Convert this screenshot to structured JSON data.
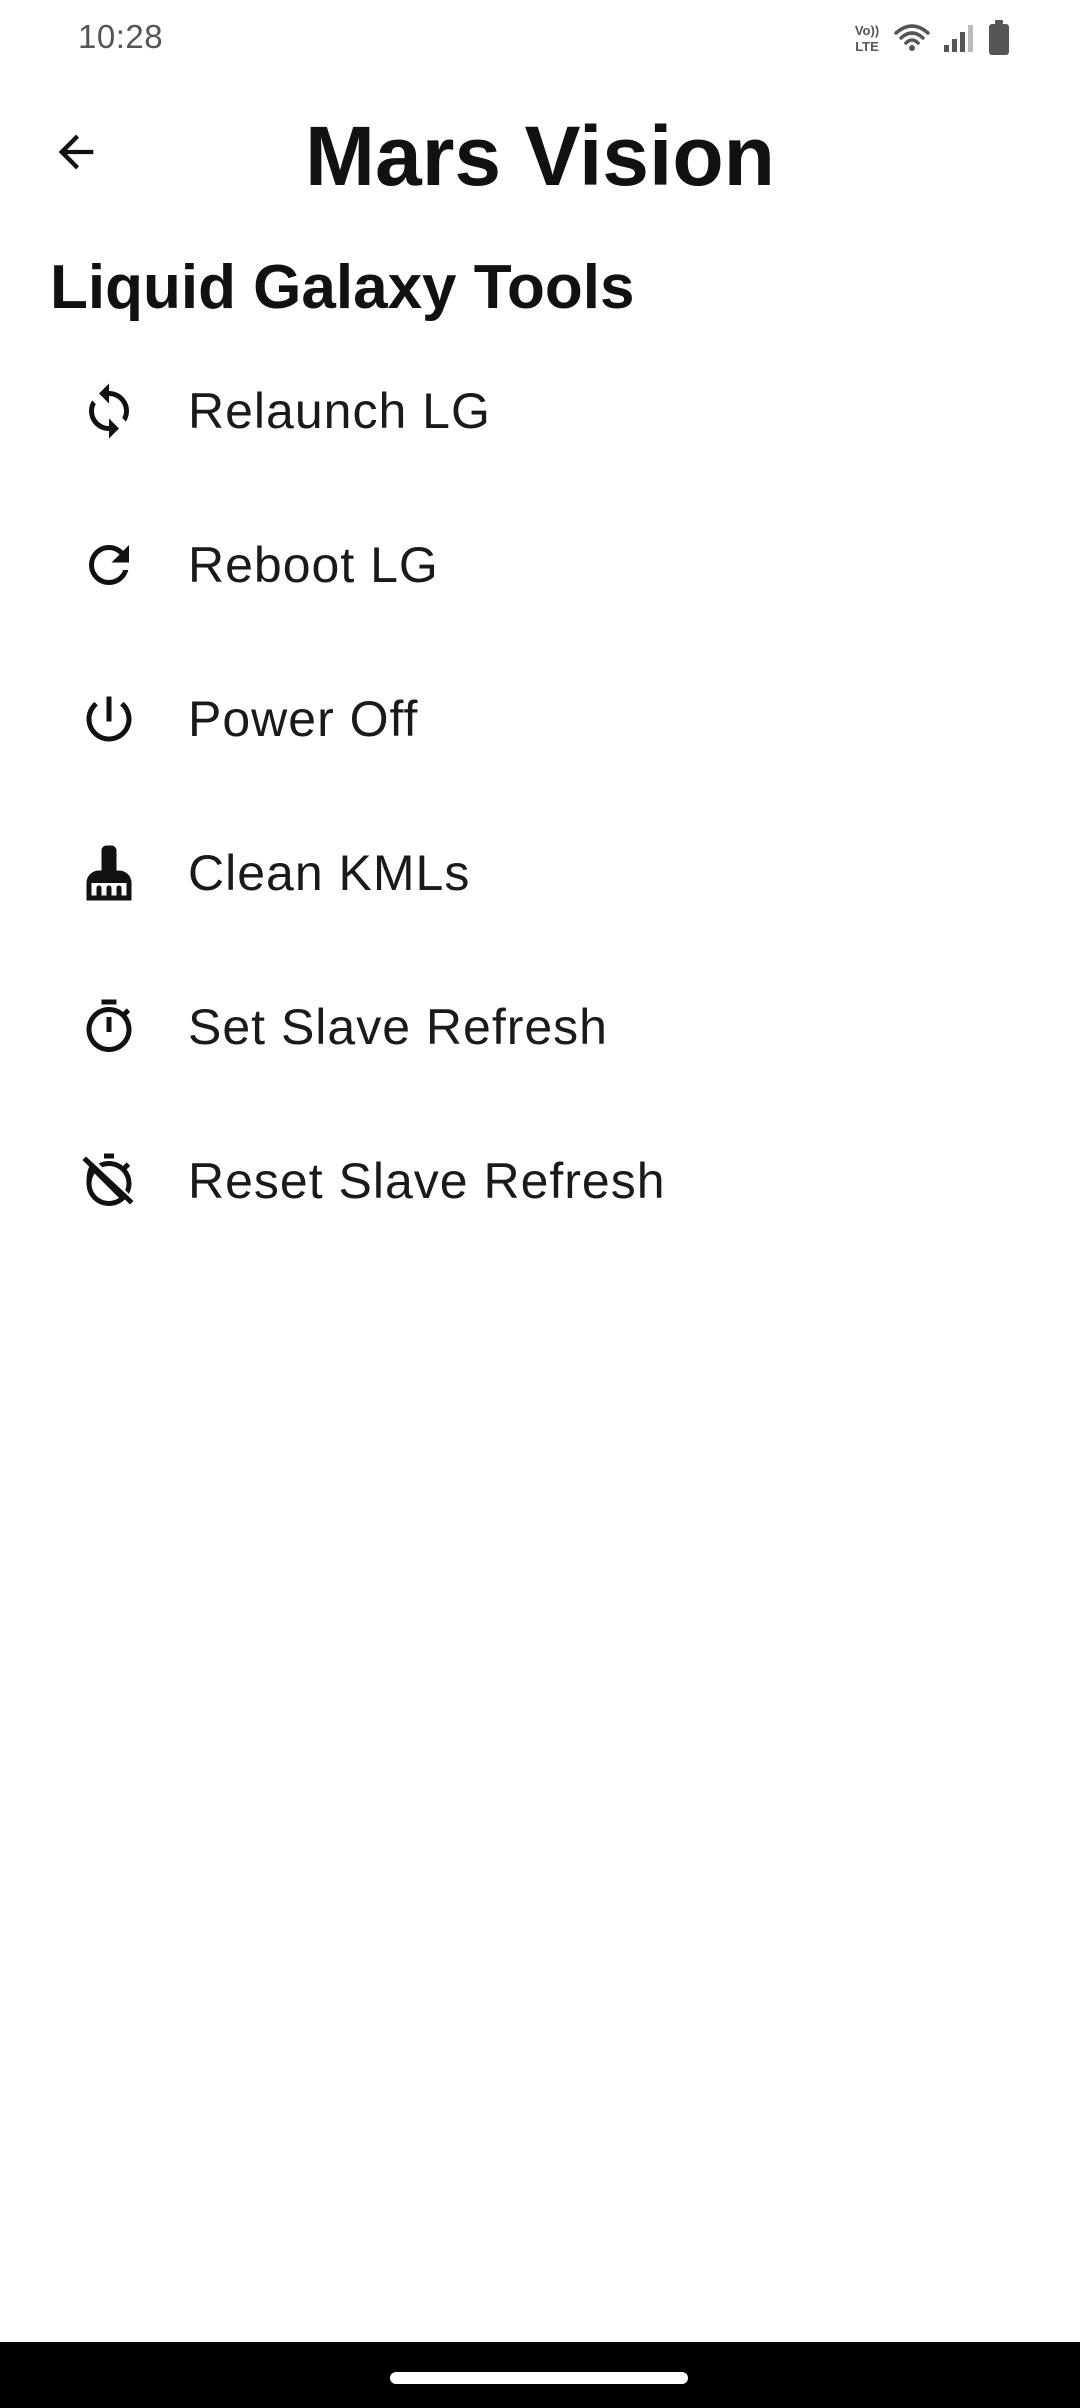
{
  "status_bar": {
    "time": "10:28",
    "icons": [
      "volte-icon",
      "wifi-icon",
      "signal-icon",
      "battery-icon"
    ],
    "volte_label": "VoLTE"
  },
  "app_bar": {
    "title": "Mars Vision",
    "back_icon": "arrow-back-icon"
  },
  "section": {
    "title": "Liquid Galaxy Tools"
  },
  "tools": [
    {
      "label": "Relaunch LG",
      "icon": "sync-icon"
    },
    {
      "label": "Reboot LG",
      "icon": "refresh-icon"
    },
    {
      "label": "Power Off",
      "icon": "power-icon"
    },
    {
      "label": "Clean KMLs",
      "icon": "broom-icon"
    },
    {
      "label": "Set Slave Refresh",
      "icon": "timer-icon"
    },
    {
      "label": "Reset Slave Refresh",
      "icon": "timer-off-icon"
    }
  ],
  "colors": {
    "text": "#1a1a1a",
    "background": "#ffffff",
    "nav_bar": "#000000",
    "status_text": "#555555"
  }
}
